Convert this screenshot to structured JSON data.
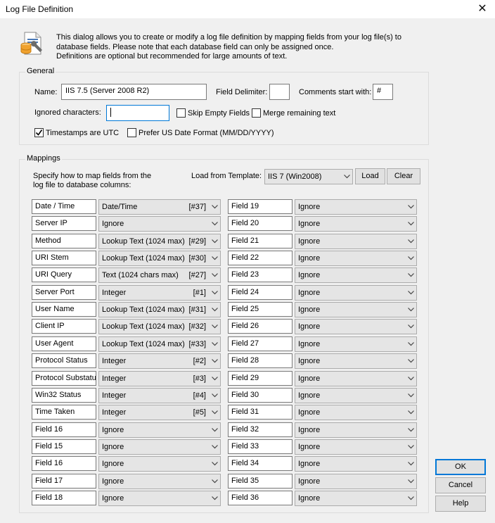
{
  "window": {
    "title": "Log File Definition"
  },
  "intro": {
    "lines": [
      "This dialog allows you to create or modify a log file definition by mapping fields from your log file(s) to",
      "database fields. Please note that each database field can only be assigned once.",
      "Definitions are optional but recommended for large amounts of text."
    ]
  },
  "general": {
    "legend": "General",
    "name_label": "Name:",
    "name_value": "IIS 7.5 (Server 2008 R2)",
    "delimiter_label": "Field Delimiter:",
    "delimiter_value": "",
    "comments_label": "Comments start with:",
    "comments_value": "#",
    "ignored_label": "Ignored characters:",
    "ignored_value": "",
    "skip_empty": {
      "label": "Skip Empty Fields",
      "checked": false
    },
    "merge_remaining": {
      "label": "Merge remaining text",
      "checked": false
    },
    "timestamps_utc": {
      "label": "Timestamps are UTC",
      "checked": true
    },
    "prefer_us_date": {
      "label": "Prefer US Date Format (MM/DD/YYYY)",
      "checked": false
    }
  },
  "mappings": {
    "legend": "Mappings",
    "description_lines": [
      "Specify how to map fields from the",
      "log file to database columns:"
    ],
    "template_label": "Load from Template:",
    "template_value": "IIS 7 (Win2008)",
    "load_label": "Load",
    "clear_label": "Clear",
    "left": [
      {
        "field": "Date / Time",
        "type": "Date/Time",
        "num": "[#37]"
      },
      {
        "field": "Server IP",
        "type": "Ignore",
        "num": ""
      },
      {
        "field": "Method",
        "type": "Lookup Text (1024 max)",
        "num": "[#29]"
      },
      {
        "field": "URI Stem",
        "type": "Lookup Text (1024 max)",
        "num": "[#30]"
      },
      {
        "field": "URI Query",
        "type": "Text (1024 chars max)",
        "num": "[#27]"
      },
      {
        "field": "Server Port",
        "type": "Integer",
        "num": "[#1]"
      },
      {
        "field": "User Name",
        "type": "Lookup Text (1024 max)",
        "num": "[#31]"
      },
      {
        "field": "Client IP",
        "type": "Lookup Text (1024 max)",
        "num": "[#32]"
      },
      {
        "field": "User Agent",
        "type": "Lookup Text (1024 max)",
        "num": "[#33]"
      },
      {
        "field": "Protocol Status",
        "type": "Integer",
        "num": "[#2]"
      },
      {
        "field": "Protocol Substatus",
        "type": "Integer",
        "num": "[#3]"
      },
      {
        "field": "Win32 Status",
        "type": "Integer",
        "num": "[#4]"
      },
      {
        "field": "Time Taken",
        "type": "Integer",
        "num": "[#5]"
      },
      {
        "field": "Field 16",
        "type": "Ignore",
        "num": ""
      },
      {
        "field": "Field 15",
        "type": "Ignore",
        "num": ""
      },
      {
        "field": "Field 16",
        "type": "Ignore",
        "num": ""
      },
      {
        "field": "Field 17",
        "type": "Ignore",
        "num": ""
      },
      {
        "field": "Field 18",
        "type": "Ignore",
        "num": ""
      }
    ],
    "right": [
      {
        "field": "Field 19",
        "type": "Ignore",
        "num": ""
      },
      {
        "field": "Field 20",
        "type": "Ignore",
        "num": ""
      },
      {
        "field": "Field 21",
        "type": "Ignore",
        "num": ""
      },
      {
        "field": "Field 22",
        "type": "Ignore",
        "num": ""
      },
      {
        "field": "Field 23",
        "type": "Ignore",
        "num": ""
      },
      {
        "field": "Field 24",
        "type": "Ignore",
        "num": ""
      },
      {
        "field": "Field 25",
        "type": "Ignore",
        "num": ""
      },
      {
        "field": "Field 26",
        "type": "Ignore",
        "num": ""
      },
      {
        "field": "Field 27",
        "type": "Ignore",
        "num": ""
      },
      {
        "field": "Field 28",
        "type": "Ignore",
        "num": ""
      },
      {
        "field": "Field 29",
        "type": "Ignore",
        "num": ""
      },
      {
        "field": "Field 30",
        "type": "Ignore",
        "num": ""
      },
      {
        "field": "Field 31",
        "type": "Ignore",
        "num": ""
      },
      {
        "field": "Field 32",
        "type": "Ignore",
        "num": ""
      },
      {
        "field": "Field 33",
        "type": "Ignore",
        "num": ""
      },
      {
        "field": "Field 34",
        "type": "Ignore",
        "num": ""
      },
      {
        "field": "Field 35",
        "type": "Ignore",
        "num": ""
      },
      {
        "field": "Field 36",
        "type": "Ignore",
        "num": ""
      }
    ]
  },
  "buttons": {
    "ok": "OK",
    "cancel": "Cancel",
    "help": "Help"
  },
  "colors": {
    "accent": "#0078d7",
    "icon_blue": "#4a78b5",
    "icon_db": "#f0a22e"
  }
}
